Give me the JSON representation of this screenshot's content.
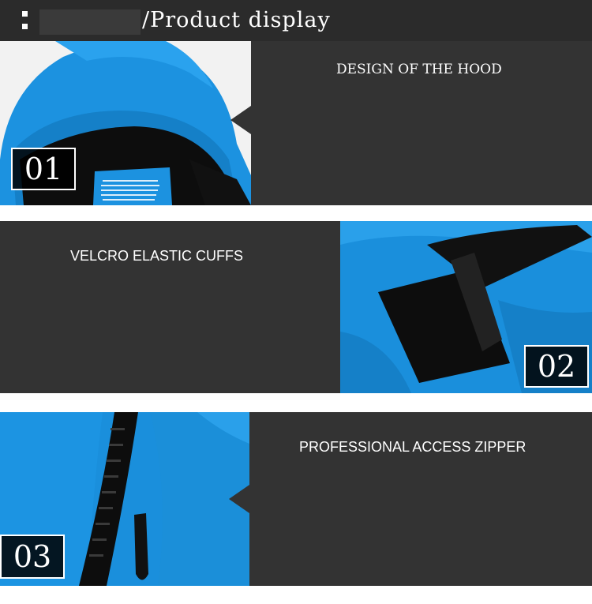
{
  "header": {
    "title": "/Product display"
  },
  "features": [
    {
      "number": "01",
      "label": "DESIGN OF THE HOOD"
    },
    {
      "number": "02",
      "label": "VELCRO ELASTIC CUFFS"
    },
    {
      "number": "03",
      "label": "PROFESSIONAL ACCESS ZIPPER"
    }
  ],
  "colors": {
    "panel": "#333333",
    "jacket_blue": "#1a8fdc",
    "lining": "#111111"
  }
}
